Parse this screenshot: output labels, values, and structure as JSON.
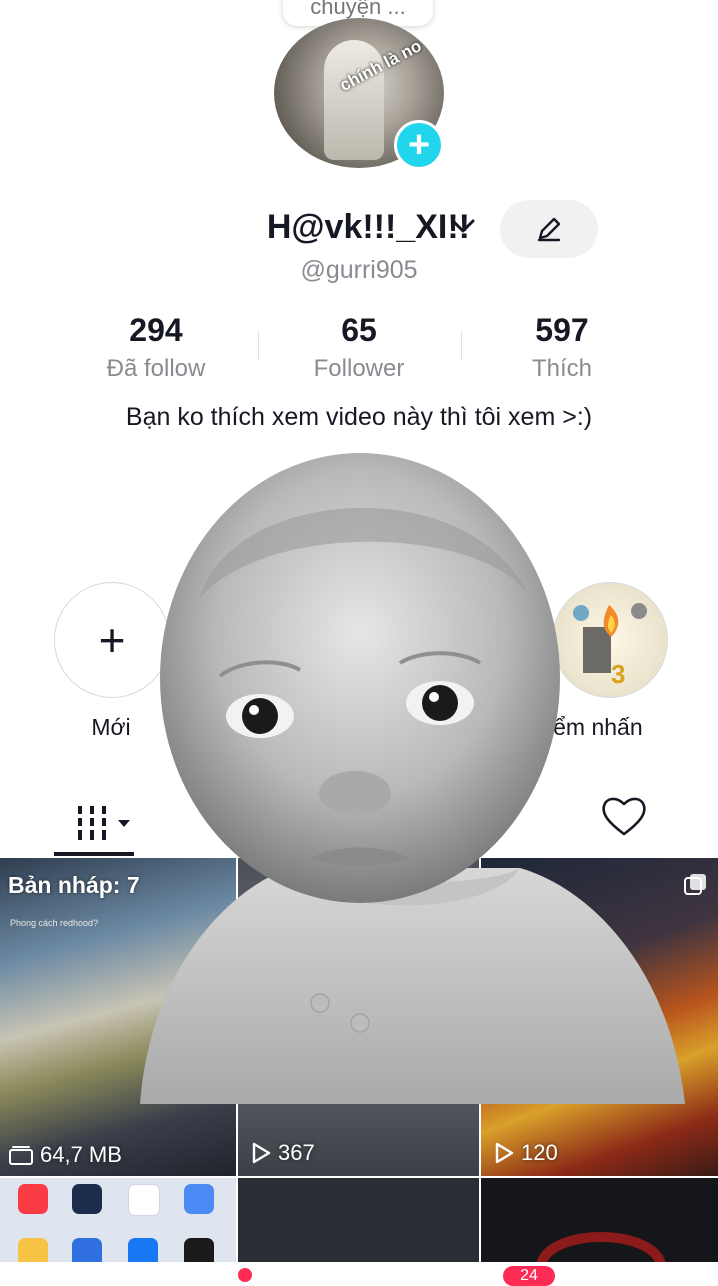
{
  "note": {
    "text": "chuyện ..."
  },
  "profile": {
    "avatar_caption": "chính là no",
    "display_name": "H@vk!!!_XI!!",
    "username": "@gurri905"
  },
  "stats": [
    {
      "value": "294",
      "label": "Đã follow"
    },
    {
      "value": "65",
      "label": "Follower"
    },
    {
      "value": "597",
      "label": "Thích"
    }
  ],
  "bio": "Bạn ko thích xem video này thì tôi xem >:)",
  "highlights": {
    "new_label": "Mới",
    "right_label": "iểm nhấn"
  },
  "tabs": {
    "grid_icon": "grid-icon",
    "liked_icon": "heart-icon"
  },
  "videos": [
    {
      "title": "Bản nháp: 7",
      "subtitle": "Phong cách redhood?",
      "meta": "64,7 MB",
      "meta_icon": "storage-icon"
    },
    {
      "meta": "367",
      "meta_icon": "play-icon"
    },
    {
      "meta": "120",
      "meta_icon": "play-icon"
    }
  ],
  "nav": {
    "inbox_badge": "24"
  },
  "colors": {
    "accent": "#fe2c55",
    "avatar_add": "#20d5ec",
    "text": "#161823",
    "muted": "#8a8b91"
  }
}
